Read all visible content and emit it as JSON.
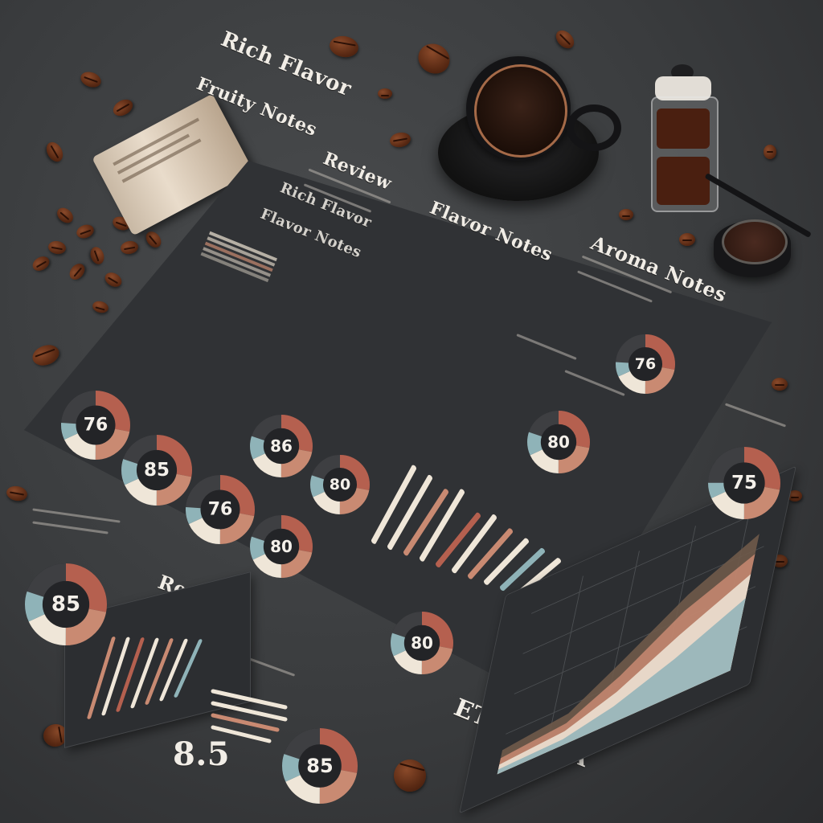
{
  "headings": {
    "rich_flavor": "Rich Flavor",
    "fruity_notes": "Fruity Notes",
    "review": "Review",
    "flavor_notes": "Flavor Notes",
    "aroma_notes": "Aroma Notes",
    "region": "Region",
    "origin": "ETHIOPIA",
    "big_score": "8.5"
  },
  "gauges": [
    {
      "id": "g1",
      "label": "76",
      "fill": 0.76
    },
    {
      "id": "g2",
      "label": "85",
      "fill": 0.85
    },
    {
      "id": "g3",
      "label": "76",
      "fill": 0.76
    },
    {
      "id": "g4",
      "label": "80",
      "fill": 0.8
    },
    {
      "id": "g5",
      "label": "86",
      "fill": 0.86
    },
    {
      "id": "g6",
      "label": "80",
      "fill": 0.8
    },
    {
      "id": "g7",
      "label": "75",
      "fill": 0.75
    },
    {
      "id": "g8",
      "label": "85",
      "fill": 0.85
    },
    {
      "id": "g9",
      "label": "85",
      "fill": 0.85
    },
    {
      "id": "g10",
      "label": "80",
      "fill": 0.8
    },
    {
      "id": "g11",
      "label": "80",
      "fill": 0.8
    },
    {
      "id": "g12",
      "label": "76",
      "fill": 0.76
    }
  ],
  "colors": {
    "accent_copper": "#c98a72",
    "accent_rose": "#b5604f",
    "accent_teal": "#8fb3b8",
    "accent_cream": "#efe6d8",
    "track": "#3e3f42"
  }
}
